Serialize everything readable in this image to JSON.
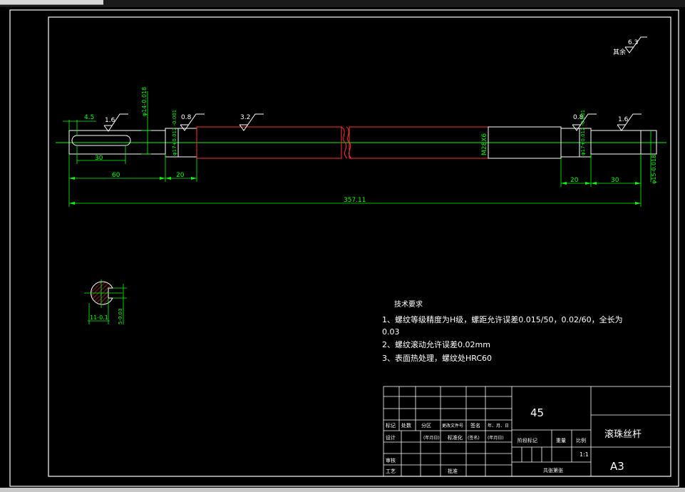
{
  "colors": {
    "background": "#000000",
    "frame": "#ffffff",
    "dimension": "#00ff00",
    "outline": "#ffffff",
    "thread": "#ff3333",
    "hatch": "#ff3333"
  },
  "roughness": {
    "other": {
      "label": "其余",
      "value": "6.3"
    },
    "marks": [
      "1.6",
      "0.8",
      "3.2",
      "0.8",
      "1.6"
    ]
  },
  "dimensions": {
    "left_gap": "4.5",
    "left_dia": "φ14-0.018",
    "key_len": "30",
    "left_len": "60",
    "bearing_len_left": "20",
    "bearing_dia_left": "φ17+0.012 -0.001",
    "thread": "M28X6",
    "bearing_dia_right": "φ17+0.012 -0.001",
    "bearing_len_right": "20",
    "right_len": "30",
    "right_dia": "φ15-0.018",
    "total_len": "357.11",
    "section_w": "11-0.1",
    "section_h": "5-0.03"
  },
  "tech": {
    "heading": "技术要求",
    "line1": "1、螺纹等级精度为H级，螺距允许误差0.015/50，0.02/60，全长为",
    "line1b": "0.03",
    "line2": "2、螺纹滚动允许误差0.02mm",
    "line3": "3、表面热处理，螺纹处HRC60"
  },
  "titleblock": {
    "material": "45",
    "part_name": "滚珠丝杆",
    "sheet": "A3",
    "scale": "1:1",
    "row_labels": [
      "标记",
      "处数",
      "分区",
      "更改文件号",
      "签名",
      "年、月、日"
    ],
    "design": "设计",
    "date1": "(年月日)",
    "std": "标准化",
    "sign": "(签名)",
    "date2": "(年月日)",
    "stage": "阶段标记",
    "weight": "重量",
    "ratio": "比例",
    "review": "审核",
    "process": "工艺",
    "approve": "批准",
    "sheets": "共张第张"
  }
}
